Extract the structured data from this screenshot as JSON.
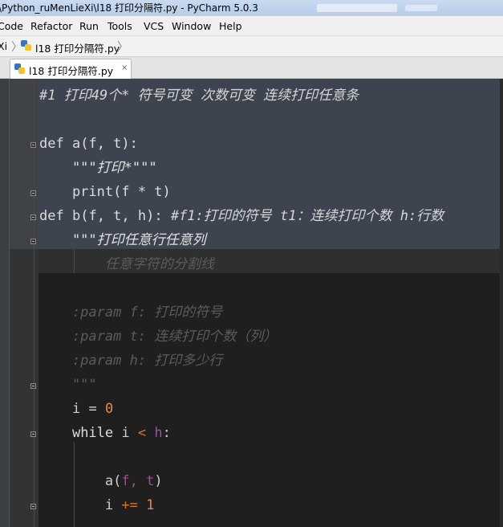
{
  "window": {
    "title": "\\Python_ruMenLieXi\\l18 打印分隔符.py - PyCharm 5.0.3"
  },
  "menu": {
    "items": [
      "Code",
      "Refactor",
      "Run",
      "Tools",
      "VCS",
      "Window",
      "Help"
    ]
  },
  "breadcrumb": {
    "project": "Xi",
    "file": "l18 打印分隔符.py"
  },
  "tabs": [
    {
      "label": "l18 打印分隔符.py",
      "close": "×"
    }
  ],
  "code": {
    "lines": [
      {
        "text": "#1 打印49个* 符号可变 次数可变 连续打印任意条"
      },
      {
        "text": ""
      },
      {
        "kw": "def",
        "name": "a",
        "sig": "(f, t):"
      },
      {
        "text": "    \"\"\"打印*\"\"\""
      },
      {
        "text": "    print(f * t)"
      },
      {
        "kw": "def",
        "name": "b",
        "sig": "(f, t, h):",
        "comment": "#f1:打印的符号 t1：连续打印个数 h:行数"
      },
      {
        "text": "    \"\"\"打印任意行任意列"
      },
      {
        "text": "        任意字符的分割线"
      },
      {
        "text": ""
      },
      {
        "text": "    :param f: 打印的符号"
      },
      {
        "text": "    :param t: 连续打印个数（列）"
      },
      {
        "text": "    :param h: 打印多少行"
      },
      {
        "text": "    \"\"\""
      },
      {
        "var": "i",
        "op": "=",
        "num": "0"
      },
      {
        "kw": "while",
        "cond_var": "i",
        "lt": "<",
        "cond_rhs": "h",
        "colon": ":"
      },
      {
        "text": ""
      },
      {
        "call": "a",
        "args": "f,",
        "arg2": "t",
        "close": ")"
      },
      {
        "var": "i",
        "op": "+=",
        "num": "1"
      }
    ]
  }
}
